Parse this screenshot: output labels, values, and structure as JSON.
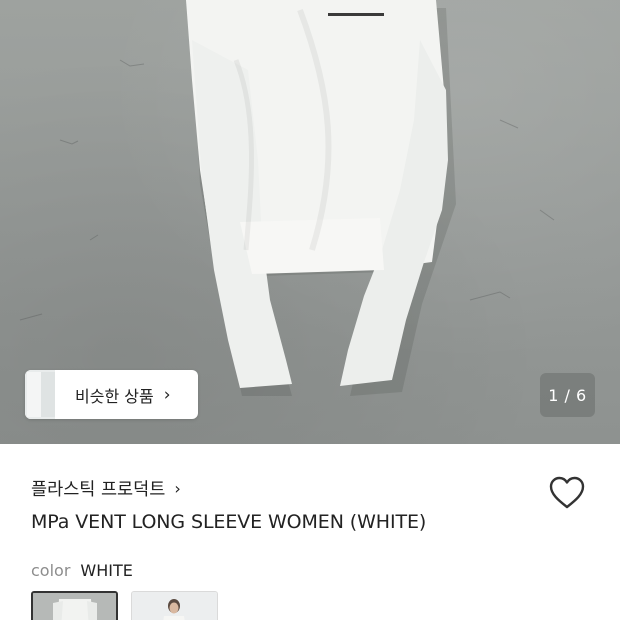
{
  "gallery": {
    "similar_products_label": "비슷한 상품",
    "similar_products_arrow": "›",
    "image_counter": "1 / 6"
  },
  "product": {
    "brand": "플라스틱 프로덕트",
    "brand_arrow": "›",
    "title": "MPa VENT LONG SLEEVE WOMEN (WHITE)",
    "color_label": "color",
    "color_value": "WHITE"
  },
  "icons": {
    "wishlist": "heart-outline-icon",
    "similar_arrow": "chevron-right-icon",
    "brand_arrow": "chevron-right-icon"
  },
  "colors": {
    "background": "#ffffff",
    "text_primary": "#222222",
    "text_secondary": "#8d8d8d",
    "photo_floor": "#999d9b",
    "garment": "#f3f3f1"
  }
}
